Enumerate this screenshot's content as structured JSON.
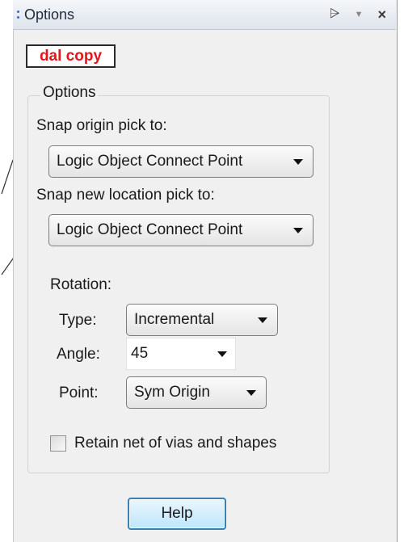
{
  "window": {
    "title": "Options",
    "pin_glyph": "⩥",
    "dropdown_glyph": "▼",
    "close_glyph": "×"
  },
  "tag": {
    "label": "dal copy",
    "color": "#e8141c"
  },
  "options_group": {
    "legend": "Options",
    "snap_origin_label": "Snap origin pick to:",
    "snap_origin_value": "Logic Object Connect Point",
    "snap_new_label": "Snap new location pick to:",
    "snap_new_value": "Logic Object Connect Point",
    "rotation": {
      "heading": "Rotation:",
      "type_label": "Type:",
      "type_value": "Incremental",
      "angle_label": "Angle:",
      "angle_value": "45",
      "point_label": "Point:",
      "point_value": "Sym Origin"
    },
    "retain_label": "Retain net of vias and shapes",
    "retain_checked": false
  },
  "help_label": "Help",
  "icons": [
    "grip-icon",
    "pin-icon",
    "dropdown-icon",
    "close-icon",
    "chevron-down-icon"
  ]
}
